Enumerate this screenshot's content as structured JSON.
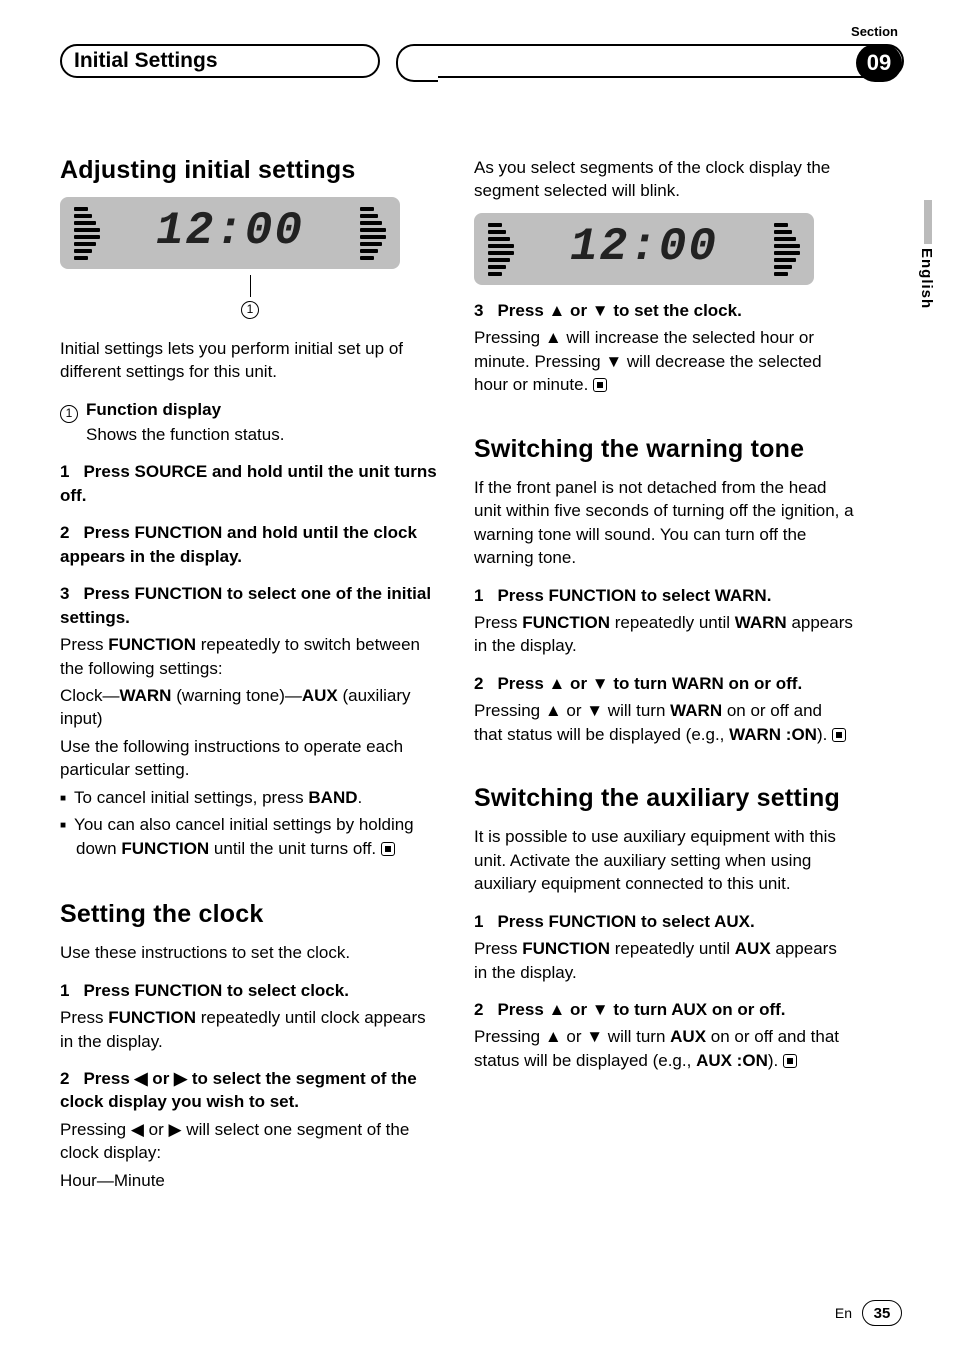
{
  "header": {
    "sectionLabel": "Section",
    "title": "Initial Settings",
    "badge": "09"
  },
  "sideTab": {
    "language": "English"
  },
  "footer": {
    "langCode": "En",
    "pageNum": "35"
  },
  "lcd": {
    "display1": "12:00",
    "callout": "1",
    "display2": "12:00"
  },
  "left": {
    "h1a": "Adjusting initial settings",
    "intro": "Initial settings lets you perform initial set up of different settings for this unit.",
    "fnLabel": "Function display",
    "fnDesc": "Shows the function status.",
    "s1n": "1",
    "s1": "Press SOURCE and hold until the unit turns off.",
    "s2n": "2",
    "s2": "Press FUNCTION and hold until the clock appears in the display.",
    "s3n": "3",
    "s3": "Press FUNCTION to select one of the initial settings.",
    "s3b1a": "Press ",
    "s3b1b": "FUNCTION",
    "s3b1c": " repeatedly to switch between the following settings:",
    "s3line2a": "Clock—",
    "s3line2b": "WARN",
    "s3line2c": " (warning tone)—",
    "s3line2d": "AUX",
    "s3line2e": " (auxiliary input)",
    "s3line3": "Use the following instructions to operate each particular setting.",
    "bul1a": "To cancel initial settings, press ",
    "bul1b": "BAND",
    "bul1c": ".",
    "bul2a": "You can also cancel initial settings by holding down ",
    "bul2b": "FUNCTION",
    "bul2c": " until the unit turns off.",
    "h1b": "Setting the clock",
    "scIntro": "Use these instructions to set the clock.",
    "sc1n": "1",
    "sc1": "Press FUNCTION to select clock.",
    "sc1ba": "Press ",
    "sc1bb": "FUNCTION",
    "sc1bc": " repeatedly until clock appears in the display.",
    "sc2n": "2",
    "sc2": "Press ◀ or ▶ to select the segment of the clock display you wish to set.",
    "sc2b": "Pressing ◀ or ▶ will select one segment of the clock display:",
    "sc2c": "Hour—Minute"
  },
  "right": {
    "topPara": "As you select segments of the clock display the segment selected will blink.",
    "r3n": "3",
    "r3": "Press ▲ or ▼ to set the clock.",
    "r3b": "Pressing ▲ will increase the selected hour or minute. Pressing ▼ will decrease the selected hour or minute.",
    "h1c": "Switching the warning tone",
    "wIntro": "If the front panel is not detached from the head unit within five seconds of turning off the ignition, a warning tone will sound. You can turn off the warning tone.",
    "w1n": "1",
    "w1": "Press FUNCTION to select WARN.",
    "w1ba": "Press ",
    "w1bb": "FUNCTION",
    "w1bc": " repeatedly until ",
    "w1bd": "WARN",
    "w1be": " appears in the display.",
    "w2n": "2",
    "w2": "Press ▲ or ▼ to turn WARN on or off.",
    "w2ba": "Pressing ▲ or ▼ will turn ",
    "w2bb": "WARN",
    "w2bc": " on or off and that status will be displayed (e.g., ",
    "w2bd": "WARN :ON",
    "w2be": ").",
    "h1d": "Switching the auxiliary setting",
    "aIntro": "It is possible to use auxiliary equipment with this unit. Activate the auxiliary setting when using auxiliary equipment connected to this unit.",
    "a1n": "1",
    "a1": "Press FUNCTION to select AUX.",
    "a1ba": "Press ",
    "a1bb": "FUNCTION",
    "a1bc": " repeatedly until ",
    "a1bd": "AUX",
    "a1be": " appears in the display.",
    "a2n": "2",
    "a2": "Press ▲ or ▼ to turn AUX on or off.",
    "a2ba": "Pressing ▲ or ▼ will turn ",
    "a2bb": "AUX",
    "a2bc": " on or off and that status will be displayed (e.g., ",
    "a2bd": "AUX :ON",
    "a2be": ")."
  }
}
